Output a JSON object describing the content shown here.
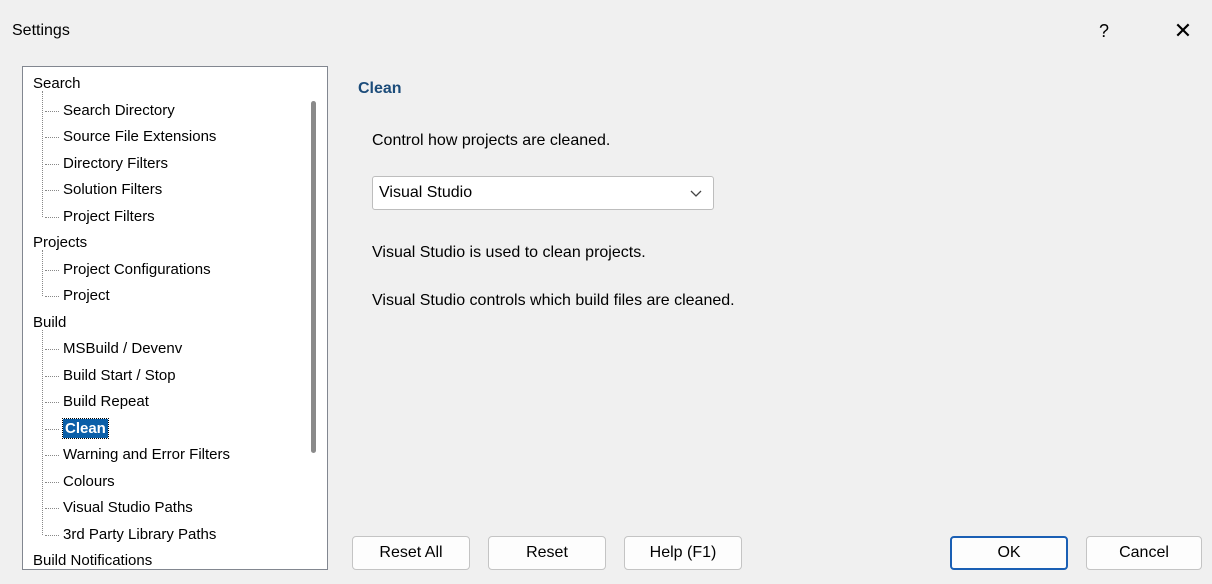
{
  "window": {
    "title": "Settings",
    "help_glyph": "?",
    "close_glyph": "✕"
  },
  "tree": {
    "nodes": [
      {
        "label": "Search",
        "level": 0
      },
      {
        "label": "Search Directory",
        "level": 1
      },
      {
        "label": "Source File Extensions",
        "level": 1
      },
      {
        "label": "Directory Filters",
        "level": 1
      },
      {
        "label": "Solution Filters",
        "level": 1
      },
      {
        "label": "Project Filters",
        "level": 1
      },
      {
        "label": "Projects",
        "level": 0
      },
      {
        "label": "Project Configurations",
        "level": 1
      },
      {
        "label": "Project",
        "level": 1
      },
      {
        "label": "Build",
        "level": 0
      },
      {
        "label": "MSBuild / Devenv",
        "level": 1
      },
      {
        "label": "Build Start / Stop",
        "level": 1
      },
      {
        "label": "Build Repeat",
        "level": 1
      },
      {
        "label": "Clean",
        "level": 1,
        "selected": true
      },
      {
        "label": "Warning and Error Filters",
        "level": 1
      },
      {
        "label": "Colours",
        "level": 1
      },
      {
        "label": "Visual Studio Paths",
        "level": 1
      },
      {
        "label": "3rd Party Library Paths",
        "level": 1
      },
      {
        "label": "Build Notifications",
        "level": 0
      }
    ]
  },
  "panel": {
    "title": "Clean",
    "intro": "Control how projects are cleaned.",
    "select_value": "Visual Studio",
    "info1": "Visual Studio is used to clean projects.",
    "info2": "Visual Studio controls which build files are cleaned."
  },
  "buttons": {
    "reset_all": "Reset All",
    "reset": "Reset",
    "help": "Help (F1)",
    "ok": "OK",
    "cancel": "Cancel"
  },
  "icons": {
    "select_chevron": "chevron-down-icon"
  }
}
